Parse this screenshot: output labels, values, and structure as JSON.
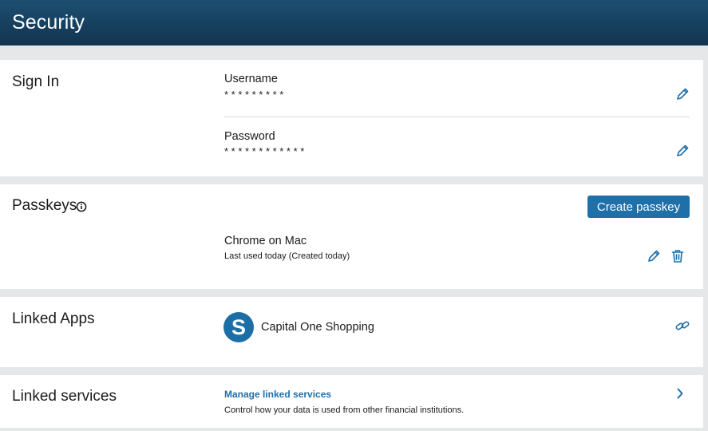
{
  "header": {
    "title": "Security"
  },
  "sign_in": {
    "title": "Sign In",
    "username": {
      "label": "Username",
      "value": "*********"
    },
    "password": {
      "label": "Password",
      "value": "************"
    }
  },
  "passkeys": {
    "title": "Passkeys",
    "create_button": "Create passkey",
    "items": [
      {
        "name": "Chrome on Mac",
        "detail": "Last used today (Created today)"
      }
    ]
  },
  "linked_apps": {
    "title": "Linked Apps",
    "apps": [
      {
        "name": "Capital One Shopping",
        "logo_letter": "S"
      }
    ]
  },
  "linked_services": {
    "title": "Linked services",
    "link": "Manage linked services",
    "description": "Control how your data is used from other financial institutions."
  },
  "colors": {
    "header": "#163e5d",
    "accent": "#1f6fa8",
    "background": "#e6e7e9",
    "card": "#ffffff"
  },
  "icons": [
    "pencil-icon",
    "trash-icon",
    "info-icon",
    "link-icon",
    "chevron-right-icon"
  ]
}
